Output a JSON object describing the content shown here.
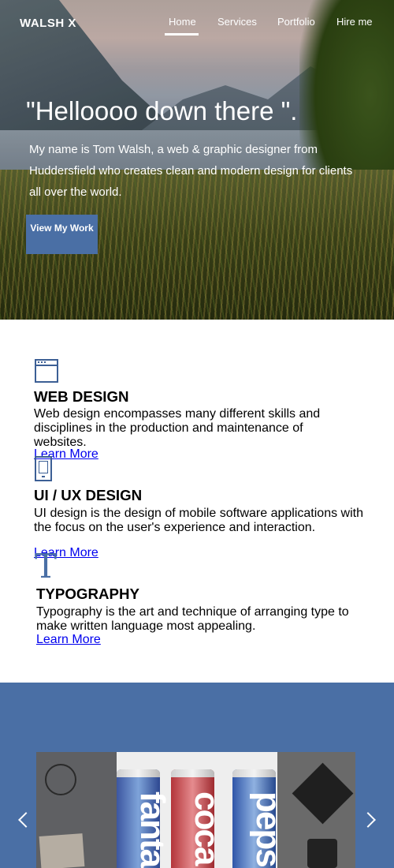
{
  "header": {
    "brand": "WALSH X",
    "nav": [
      {
        "label": "Home",
        "active": true
      },
      {
        "label": "Services",
        "active": false
      },
      {
        "label": "Portfolio",
        "active": false
      },
      {
        "label": "Hire me",
        "active": false
      }
    ]
  },
  "hero": {
    "title": "\"Helloooo down there \".",
    "text": "My name is Tom Walsh, a web & graphic designer from Huddersfield who creates clean and modern design for clients all over the world.",
    "button_label": "View My Work"
  },
  "services": [
    {
      "icon": "browser-window-icon",
      "title": "WEB DESIGN",
      "text": "Web design encompasses many different skills and disciplines in the production and maintenance of websites.",
      "link": "Learn More"
    },
    {
      "icon": "mobile-phone-icon",
      "title": "UI / UX DESIGN",
      "text": "UI design is the design of mobile software applications with the focus on the user's experience and interaction.",
      "link": "Learn More"
    },
    {
      "icon": "typography-t-icon",
      "icon_glyph": "T",
      "title": "TYPOGRAPHY",
      "text": "Typography is the art and technique of arranging type to make written language most appealing.",
      "link": "Learn More"
    }
  ],
  "portfolio": {
    "cans": [
      "fanta",
      "coca",
      "pepsi"
    ],
    "prev_icon": "chevron-left-icon",
    "next_icon": "chevron-right-icon"
  },
  "colors": {
    "accent": "#4a6fa5",
    "icon": "#3c5f95",
    "portfolio_bg": "#4a6fa5"
  }
}
